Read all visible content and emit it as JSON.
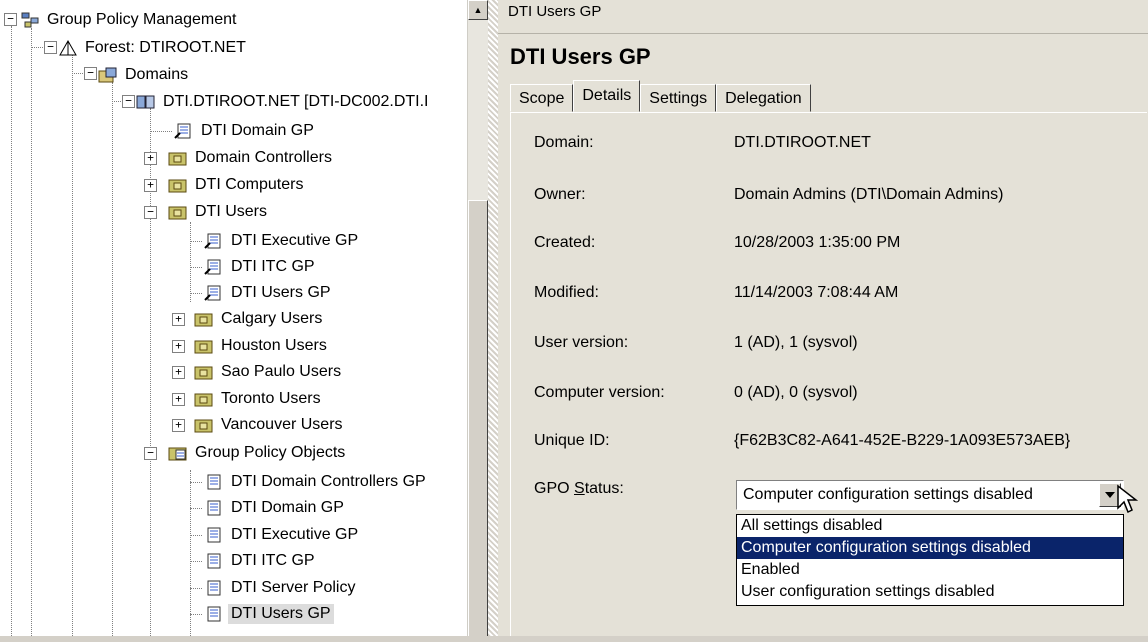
{
  "tree": {
    "root": "Group Policy Management",
    "forest": "Forest: DTIROOT.NET",
    "domains": "Domains",
    "domain": "DTI.DTIROOT.NET [DTI-DC002.DTI.I",
    "linked": [
      {
        "label": "DTI Domain GP",
        "kind": "gpo-link"
      },
      {
        "label": "Domain Controllers",
        "kind": "ou"
      },
      {
        "label": "DTI Computers",
        "kind": "ou"
      },
      {
        "label": "DTI Users",
        "kind": "ou"
      }
    ],
    "dti_users_children": [
      {
        "label": "DTI Executive GP",
        "kind": "gpo-link"
      },
      {
        "label": "DTI ITC GP",
        "kind": "gpo-link"
      },
      {
        "label": "DTI Users GP",
        "kind": "gpo-link"
      },
      {
        "label": "Calgary Users",
        "kind": "ou"
      },
      {
        "label": "Houston Users",
        "kind": "ou"
      },
      {
        "label": "Sao Paulo Users",
        "kind": "ou"
      },
      {
        "label": "Toronto Users",
        "kind": "ou"
      },
      {
        "label": "Vancouver Users",
        "kind": "ou"
      }
    ],
    "gpo_folder": "Group Policy Objects",
    "gpo_items": [
      {
        "label": "DTI Domain Controllers GP"
      },
      {
        "label": "DTI Domain GP"
      },
      {
        "label": "DTI Executive GP"
      },
      {
        "label": "DTI ITC GP"
      },
      {
        "label": "DTI Server Policy"
      },
      {
        "label": "DTI Users GP",
        "selected": true
      }
    ]
  },
  "breadcrumb": "DTI Users GP",
  "title": "DTI Users GP",
  "tabs": [
    "Scope",
    "Details",
    "Settings",
    "Delegation"
  ],
  "active_tab": "Details",
  "details": {
    "domain_label": "Domain:",
    "domain": "DTI.DTIROOT.NET",
    "owner_label": "Owner:",
    "owner": "Domain Admins (DTI\\Domain Admins)",
    "created_label": "Created:",
    "created": "10/28/2003 1:35:00 PM",
    "modified_label": "Modified:",
    "modified": "11/14/2003 7:08:44 AM",
    "user_version_label": "User version:",
    "user_version": "1 (AD), 1 (sysvol)",
    "computer_version_label": "Computer version:",
    "computer_version": "0 (AD), 0 (sysvol)",
    "unique_id_label": "Unique ID:",
    "unique_id": "{F62B3C82-A641-452E-B229-1A093E573AEB}",
    "gpo_status_label_pre": "GPO ",
    "gpo_status_label_accel": "S",
    "gpo_status_label_post": "tatus:",
    "gpo_status": "Computer configuration settings disabled",
    "gpo_status_options": [
      "All settings disabled",
      "Computer configuration settings disabled",
      "Enabled",
      "User configuration settings disabled"
    ]
  },
  "colors": {
    "selection": "#0a246a",
    "panel": "#e4e1d7",
    "ou_folder": "#c9c36a",
    "gpo_scroll": "#3a5fcd"
  }
}
